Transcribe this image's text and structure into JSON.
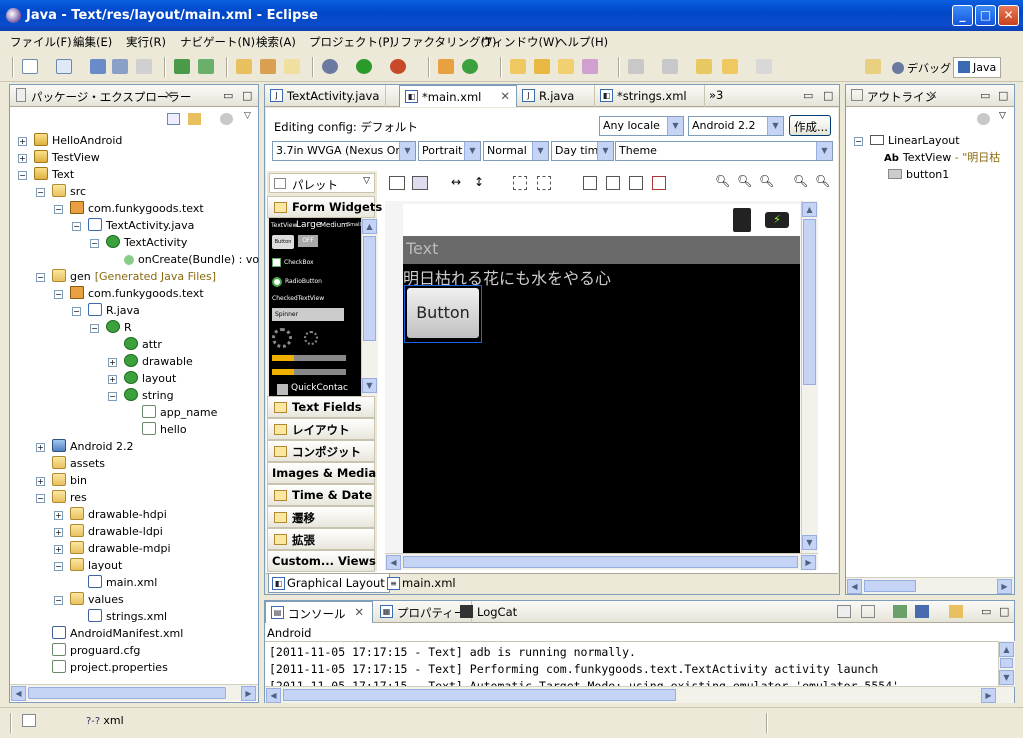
{
  "window": {
    "title": "Java - Text/res/layout/main.xml - Eclipse"
  },
  "menu": [
    "ファイル(F)",
    "編集(E)",
    "実行(R)",
    "ナビゲート(N)",
    "検索(A)",
    "プロジェクト(P)",
    "リファクタリング(T)",
    "ウィンドウ(W)",
    "ヘルプ(H)"
  ],
  "perspectives": {
    "debug": "デバッグ",
    "java": "Java"
  },
  "explorer": {
    "title": "パッケージ・エクスプローラー",
    "tree": [
      {
        "label": "HelloAndroid",
        "icon": "project-icon"
      },
      {
        "label": "TestView",
        "icon": "project-icon"
      },
      {
        "label": "Text",
        "icon": "project-icon"
      },
      {
        "label": "src",
        "icon": "folder-icon"
      },
      {
        "label": "com.funkygoods.text",
        "icon": "package-icon"
      },
      {
        "label": "TextActivity.java",
        "icon": "java-file-icon"
      },
      {
        "label": "TextActivity",
        "icon": "class-icon"
      },
      {
        "label": "onCreate(Bundle) : vo",
        "icon": "method-icon"
      },
      {
        "label": "gen",
        "icon": "folder-icon",
        "deco": "[Generated Java Files]"
      },
      {
        "label": "com.funkygoods.text",
        "icon": "package-icon"
      },
      {
        "label": "R.java",
        "icon": "java-file-icon"
      },
      {
        "label": "R",
        "icon": "class-icon"
      },
      {
        "label": "attr",
        "icon": "class-icon"
      },
      {
        "label": "drawable",
        "icon": "class-icon"
      },
      {
        "label": "layout",
        "icon": "class-icon"
      },
      {
        "label": "string",
        "icon": "class-icon"
      },
      {
        "label": "app_name",
        "icon": "field-icon"
      },
      {
        "label": "hello",
        "icon": "field-icon"
      },
      {
        "label": "Android 2.2",
        "icon": "library-icon"
      },
      {
        "label": "assets",
        "icon": "folder-icon"
      },
      {
        "label": "bin",
        "icon": "folder-icon"
      },
      {
        "label": "res",
        "icon": "folder-icon"
      },
      {
        "label": "drawable-hdpi",
        "icon": "folder-icon"
      },
      {
        "label": "drawable-ldpi",
        "icon": "folder-icon"
      },
      {
        "label": "drawable-mdpi",
        "icon": "folder-icon"
      },
      {
        "label": "layout",
        "icon": "folder-icon"
      },
      {
        "label": "main.xml",
        "icon": "xml-file-icon"
      },
      {
        "label": "values",
        "icon": "folder-icon"
      },
      {
        "label": "strings.xml",
        "icon": "xml-file-icon"
      },
      {
        "label": "AndroidManifest.xml",
        "icon": "xml-file-icon"
      },
      {
        "label": "proguard.cfg",
        "icon": "file-icon"
      },
      {
        "label": "project.properties",
        "icon": "file-icon"
      }
    ]
  },
  "editor": {
    "tabs": [
      "TextActivity.java",
      "*main.xml",
      "R.java",
      "*strings.xml"
    ],
    "overflow": "»3",
    "config_label": "Editing config: デフォルト",
    "locale": "Any locale",
    "target": "Android 2.2",
    "create_button": "作成...",
    "device": "3.7in WVGA (Nexus One)",
    "orientation": "Portrait",
    "mode": "Normal",
    "daytime": "Day time",
    "theme": "Theme",
    "palette_title": "パレット",
    "palette_groups": [
      "Form Widgets",
      "Text Fields",
      "レイアウト",
      "コンポジット",
      "Images & Media",
      "Time & Date",
      "遷移",
      "拡張",
      "Custom... Views"
    ],
    "palette_preview": {
      "textview": "TextView",
      "large": "Large",
      "medium": "Medium",
      "small": "Small",
      "button": "Button",
      "off": "OFF",
      "checkbox": "CheckBox",
      "radio": "RadioButton",
      "checked": "CheckedTextView",
      "spinner": "Spinner",
      "quick": "QuickContac"
    },
    "device_screen": {
      "app_title": "Text",
      "text": "明日枯れる花にも水をやる心",
      "button": "Button"
    },
    "bottom_tabs": [
      "Graphical Layout",
      "main.xml"
    ]
  },
  "outline": {
    "title": "アウトライン",
    "items": [
      {
        "label": "LinearLayout"
      },
      {
        "label": "TextView",
        "extra": " - \"明日枯"
      },
      {
        "label": "button1"
      }
    ]
  },
  "console": {
    "tabs": [
      "コンソール",
      "プロパティー",
      "LogCat"
    ],
    "name": "Android",
    "lines": [
      "[2011-11-05 17:17:15 - Text] adb is running normally.",
      "[2011-11-05 17:17:15 - Text] Performing com.funkygoods.text.TextActivity activity launch",
      "[2011-11-05 17:17:15 - Text] Automatic Target Mode: using existing emulator 'emulator-5554'"
    ]
  },
  "status": {
    "item": "xml"
  }
}
